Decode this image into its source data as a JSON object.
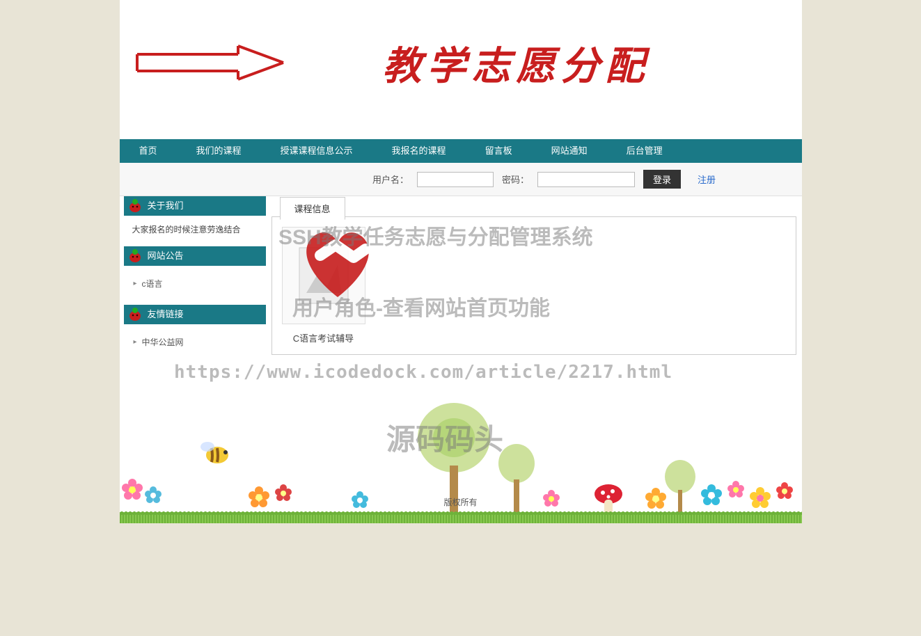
{
  "header": {
    "site_title": "教学志愿分配"
  },
  "nav": {
    "items": [
      "首页",
      "我们的课程",
      "授课课程信息公示",
      "我报名的课程",
      "留言板",
      "网站通知",
      "后台管理"
    ]
  },
  "login": {
    "user_label": "用户名：",
    "pass_label": "密码：",
    "login_btn": "登录",
    "register": "注册"
  },
  "sidebar": {
    "about": {
      "title": "关于我们",
      "text": "大家报名的时候注意劳逸结合"
    },
    "notice": {
      "title": "网站公告",
      "items": [
        "c语言"
      ]
    },
    "links": {
      "title": "友情链接",
      "items": [
        "中华公益网"
      ]
    }
  },
  "main": {
    "tab_label": "课程信息",
    "course": {
      "caption": "C语言考试辅导"
    }
  },
  "footer": {
    "copyright": "版权所有"
  },
  "watermark": {
    "line1": "SSH教学任务志愿与分配管理系统",
    "line2": "用户角色-查看网站首页功能",
    "url": "https://www.icodedock.com/article/2217.html",
    "brand": "源码码头"
  }
}
